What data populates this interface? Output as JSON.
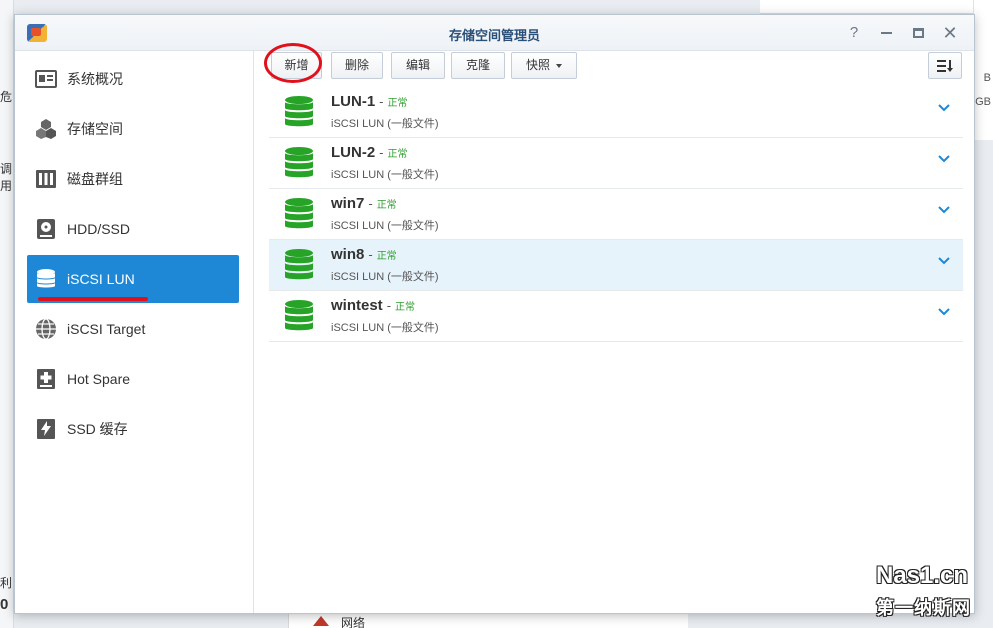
{
  "window": {
    "title": "存储空间管理员"
  },
  "background": {
    "left_fragments": [
      "危",
      "调用",
      "利",
      "0"
    ],
    "right_fragments": [
      "B",
      "GB"
    ],
    "bottom_item": "网络"
  },
  "sidebar": {
    "items": [
      {
        "label": "系统概况",
        "icon": "overview-icon"
      },
      {
        "label": "存储空间",
        "icon": "storage-cubes-icon"
      },
      {
        "label": "磁盘群组",
        "icon": "disk-group-icon"
      },
      {
        "label": "HDD/SSD",
        "icon": "hdd-icon"
      },
      {
        "label": "iSCSI LUN",
        "icon": "database-icon",
        "active": true
      },
      {
        "label": "iSCSI Target",
        "icon": "globe-icon"
      },
      {
        "label": "Hot Spare",
        "icon": "hot-spare-icon"
      },
      {
        "label": "SSD 缓存",
        "icon": "ssd-cache-icon"
      }
    ]
  },
  "toolbar": {
    "add": "新增",
    "delete": "删除",
    "edit": "编辑",
    "clone": "克隆",
    "snapshot": "快照"
  },
  "luns": [
    {
      "name": "LUN-1",
      "status": "正常",
      "type": "iSCSI LUN (一般文件)"
    },
    {
      "name": "LUN-2",
      "status": "正常",
      "type": "iSCSI LUN (一般文件)"
    },
    {
      "name": "win7",
      "status": "正常",
      "type": "iSCSI LUN (一般文件)"
    },
    {
      "name": "win8",
      "status": "正常",
      "type": "iSCSI LUN (一般文件)",
      "selected": true
    },
    {
      "name": "wintest",
      "status": "正常",
      "type": "iSCSI LUN (一般文件)"
    }
  ],
  "colors": {
    "accent": "#1e88d6",
    "status_ok": "#2e9e2e",
    "disk_green": "#27a327",
    "annotation_red": "#e0111b"
  },
  "watermark": {
    "line1": "Nas1.cn",
    "line2": "第一纳斯网"
  }
}
